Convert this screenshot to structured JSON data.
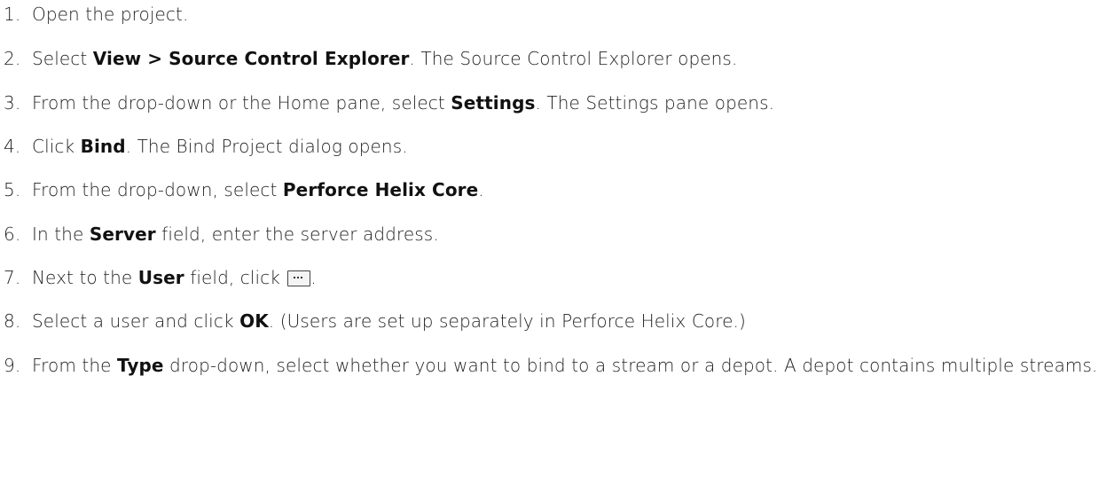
{
  "steps": [
    {
      "num": "1.",
      "parts": [
        "Open the project."
      ]
    },
    {
      "num": "2.",
      "parts": [
        "Select ",
        "View > Source Control Explorer",
        ". The Source Control Explorer opens."
      ]
    },
    {
      "num": "3.",
      "parts": [
        "From the drop-down or the Home pane, select ",
        "Settings",
        ". The Settings pane opens."
      ]
    },
    {
      "num": "4.",
      "parts": [
        "Click ",
        "Bind",
        ". The Bind Project dialog opens."
      ]
    },
    {
      "num": "5.",
      "parts": [
        "From the drop-down, select ",
        "Perforce Helix Core",
        "."
      ]
    },
    {
      "num": "6.",
      "parts": [
        "In the ",
        "Server",
        " field, enter the server address."
      ]
    },
    {
      "num": "7.",
      "parts": [
        "Next to the ",
        "User",
        " field, click ",
        "."
      ],
      "icon": "ellipsis-browse-icon"
    },
    {
      "num": "8.",
      "parts": [
        "Select a user and click ",
        "OK",
        ". (Users are set up separately in Perforce Helix Core.)"
      ]
    },
    {
      "num": "9.",
      "parts": [
        "From the ",
        "Type",
        " drop-down, select whether you want to bind to a stream or a depot. A depot contains multiple streams."
      ]
    }
  ]
}
